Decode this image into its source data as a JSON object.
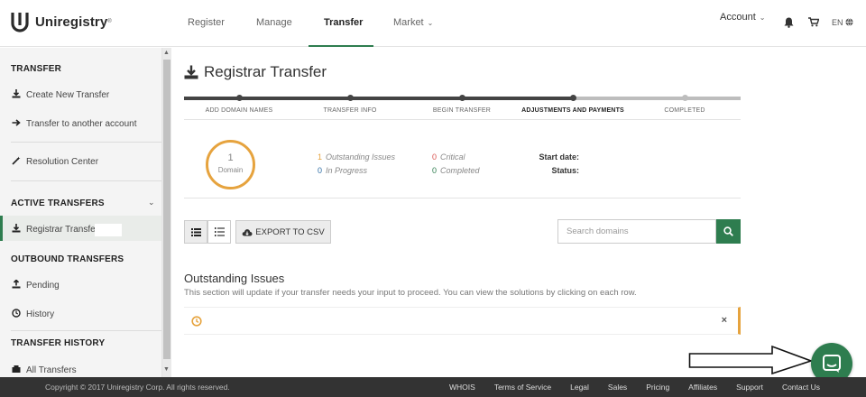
{
  "brand": {
    "name": "Uniregistry",
    "tm": "®"
  },
  "nav": {
    "items": [
      "Register",
      "Manage",
      "Transfer",
      "Market"
    ],
    "active": "Transfer",
    "account": "Account",
    "lang": "EN"
  },
  "sidebar": {
    "transfer_head": "TRANSFER",
    "create_new": "Create New Transfer",
    "to_account": "Transfer to another account",
    "resolution": "Resolution Center",
    "active_head": "ACTIVE TRANSFERS",
    "registrar_transfer": "Registrar Transfer",
    "outbound_head": "OUTBOUND TRANSFERS",
    "pending": "Pending",
    "history": "History",
    "history_head": "TRANSFER HISTORY",
    "all_transfers": "All Transfers"
  },
  "page": {
    "title": "Registrar Transfer"
  },
  "steps": {
    "s1": "ADD DOMAIN NAMES",
    "s2": "TRANSFER INFO",
    "s3": "BEGIN TRANSFER",
    "s4": "ADJUSTMENTS AND PAYMENTS",
    "s5": "COMPLETED",
    "current": "ADJUSTMENTS AND PAYMENTS"
  },
  "summary": {
    "domain_count": "1",
    "domain_label": "Domain",
    "outstanding_num": "1",
    "outstanding_label": "Outstanding Issues",
    "in_progress_num": "0",
    "in_progress_label": "In Progress",
    "critical_num": "0",
    "critical_label": "Critical",
    "completed_num": "0",
    "completed_label": "Completed",
    "start_date_label": "Start date:",
    "status_label": "Status:"
  },
  "toolbar": {
    "export_label": "EXPORT TO CSV",
    "search_placeholder": "Search domains"
  },
  "issues": {
    "title": "Outstanding Issues",
    "description": "This section will update if your transfer needs your input to proceed. You can view the solutions by clicking on each row.",
    "close_symbol": "×"
  },
  "footer": {
    "copyright": "Copyright © 2017 Uniregistry Corp. All rights reserved.",
    "whois": "WHOIS",
    "terms": "Terms of Service",
    "legal": "Legal",
    "sales": "Sales",
    "pricing": "Pricing",
    "affiliates": "Affiliates",
    "support": "Support",
    "contact": "Contact Us"
  },
  "colors": {
    "accent": "#2e7d4f",
    "warning": "#e6a33e",
    "critical": "#d9534f",
    "footer_bg": "#333333"
  },
  "icons": [
    "download-icon",
    "arrow-right-icon",
    "magic-wand-icon",
    "upload-icon",
    "clock-icon",
    "bell-icon",
    "cart-icon",
    "globe-icon",
    "list-icon",
    "numbered-list-icon",
    "cloud-download-icon",
    "search-icon",
    "close-icon",
    "chat-icon"
  ]
}
